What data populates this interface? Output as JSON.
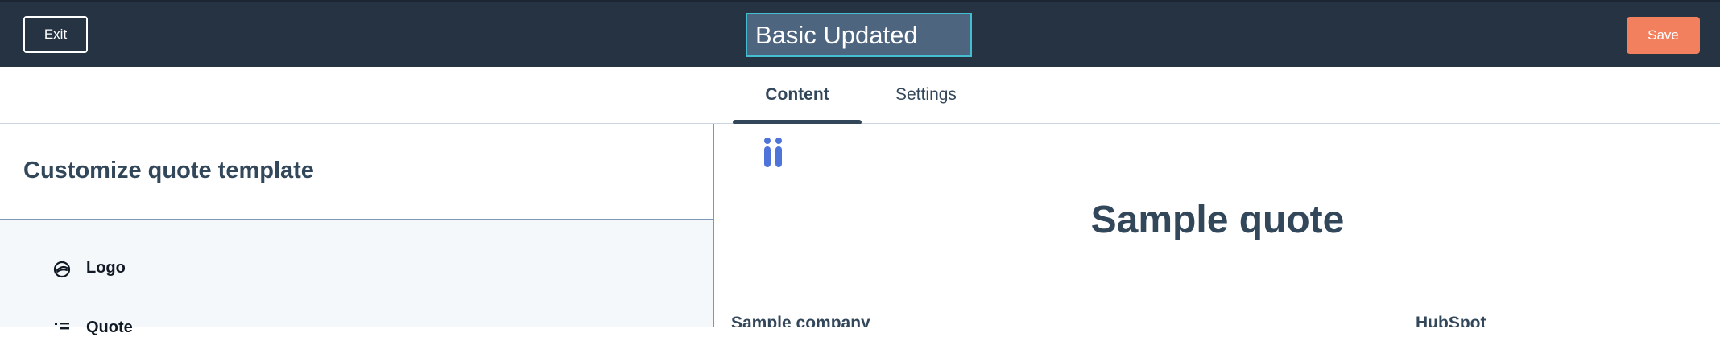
{
  "topbar": {
    "exit_label": "Exit",
    "template_name": "Basic Updated",
    "save_label": "Save"
  },
  "tabs": [
    {
      "label": "Content",
      "active": true
    },
    {
      "label": "Settings",
      "active": false
    }
  ],
  "left_panel": {
    "title": "Customize quote template",
    "items": [
      {
        "label": "Logo",
        "icon": "logo-icon"
      },
      {
        "label": "Quote",
        "icon": "text-align-icon"
      }
    ]
  },
  "preview": {
    "logo_icon": "company-logo-icon",
    "title": "Sample quote",
    "company_name": "Sample company",
    "sender_company": "HubSpot"
  },
  "colors": {
    "topbar_bg": "#253342",
    "save_button": "#f2805f",
    "input_bg": "#4e6580",
    "input_border": "#45bdd1",
    "text_primary": "#33475b",
    "logo_blue": "#4f74d9"
  }
}
